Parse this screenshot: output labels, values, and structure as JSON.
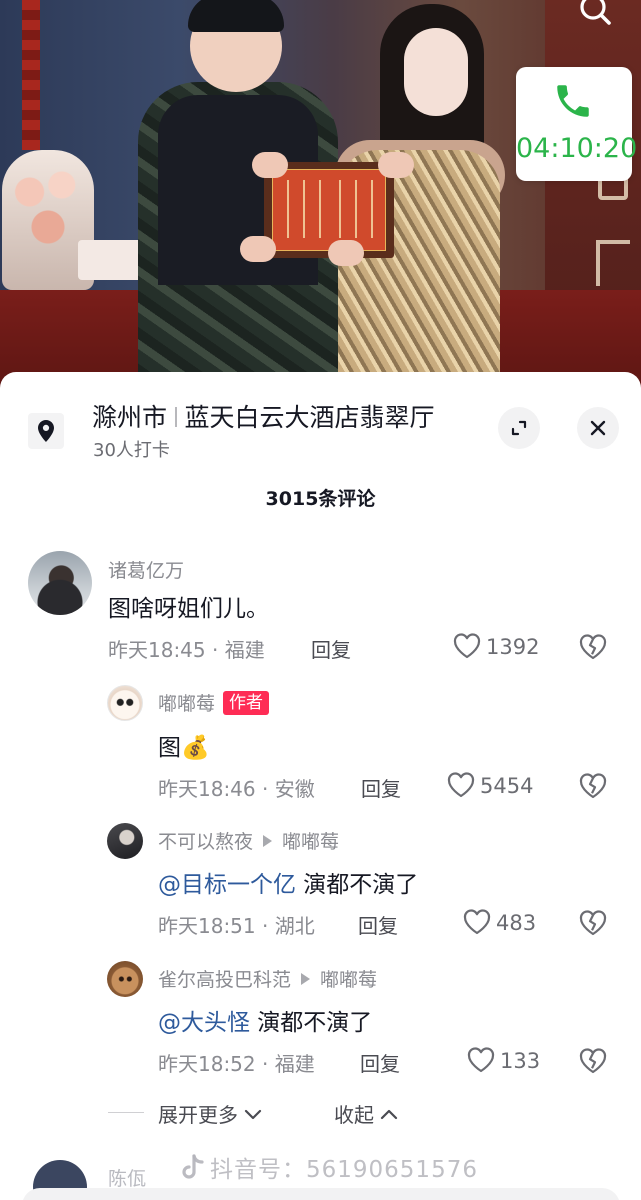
{
  "call": {
    "timer": "04:10:20"
  },
  "location": {
    "city": "滁州市",
    "venue": "蓝天白云大酒店翡翠厅",
    "checkins": "30人打卡"
  },
  "comments_header": {
    "count_label": "3015条评论"
  },
  "comments": [
    {
      "name": "诸葛亿万",
      "text": "图啥呀姐们儿。",
      "time_region": "昨天18:45 · 福建",
      "reply_label": "回复",
      "likes": "1392"
    },
    {
      "name": "嘟嘟莓",
      "badge": "作者",
      "text": "图💰",
      "time_region": "昨天18:46 · 安徽",
      "reply_label": "回复",
      "likes": "5454"
    },
    {
      "name": "不可以熬夜",
      "reply_to": "嘟嘟莓",
      "mention": "@目标一个亿",
      "text": " 演都不演了",
      "time_region": "昨天18:51 · 湖北",
      "reply_label": "回复",
      "likes": "483"
    },
    {
      "name": "雀尔高投巴科范",
      "reply_to": "嘟嘟莓",
      "mention": "@大头怪",
      "text": " 演都不演了",
      "time_region": "昨天18:52 · 福建",
      "reply_label": "回复",
      "likes": "133"
    }
  ],
  "thread_controls": {
    "expand_more": "展开更多",
    "collapse": "收起"
  },
  "next_comment": {
    "name": "陈佤"
  },
  "watermark": "抖音号：56190651576",
  "icons": {
    "search": "search-icon",
    "phone": "phone-icon",
    "location": "location-pin-icon",
    "expand": "expand-icon",
    "close": "close-icon",
    "like": "heart-icon",
    "dislike": "broken-heart-icon",
    "chevron_down": "chevron-down-icon",
    "chevron_up": "chevron-up-icon",
    "reply_arrow": "reply-arrow-icon"
  },
  "colors": {
    "accent_green": "#2bb44a",
    "author_badge": "#fe2c55",
    "mention": "#2e5a9c"
  }
}
